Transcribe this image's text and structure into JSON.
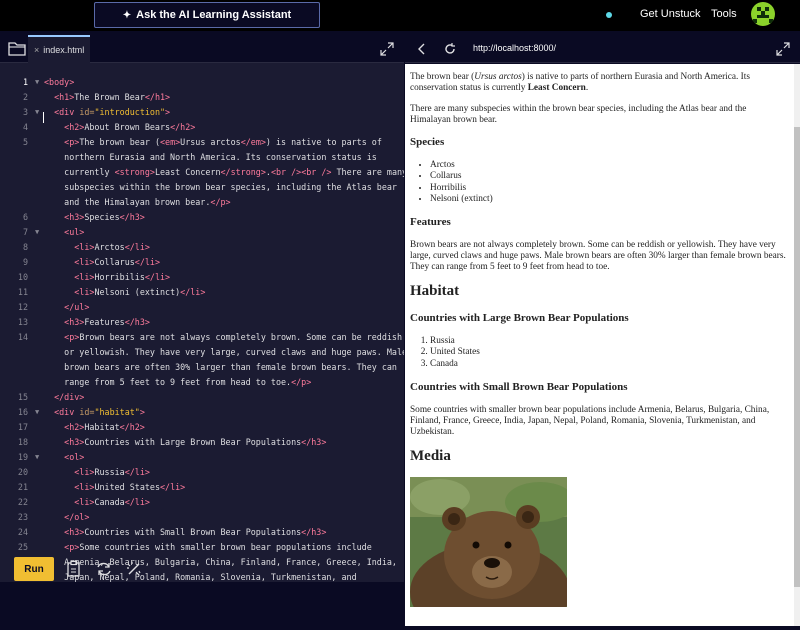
{
  "topbar": {
    "ai_button": "Ask the AI Learning Assistant",
    "get_unstuck": "Get Unstuck",
    "tools": "Tools"
  },
  "editor": {
    "tab_name": "index.html",
    "tab_close": "×",
    "run_label": "Run",
    "lines": [
      {
        "n": "1",
        "fold": true,
        "html": "<span class='tag'>&lt;body&gt;</span>"
      },
      {
        "n": "2",
        "html": "  <span class='tag'>&lt;h1&gt;</span>The Brown Bear<span class='tag'>&lt;/h1&gt;</span>"
      },
      {
        "n": "3",
        "fold": true,
        "html": "  <span class='tag'>&lt;div</span> <span class='attr'>id=</span><span class='str'>\"introduction\"</span><span class='tag'>&gt;</span>"
      },
      {
        "n": "4",
        "html": "    <span class='tag'>&lt;h2&gt;</span>About Brown Bears<span class='tag'>&lt;/h2&gt;</span>"
      },
      {
        "n": "5",
        "html": "    <span class='tag'>&lt;p&gt;</span>The brown bear (<span class='tag'>&lt;em&gt;</span>Ursus arctos<span class='tag'>&lt;/em&gt;</span>) is native to parts of"
      },
      {
        "n": "",
        "html": "    northern Eurasia and North America. Its conservation status is"
      },
      {
        "n": "",
        "html": "    currently <span class='tag'>&lt;strong&gt;</span>Least Concern<span class='tag'>&lt;/strong&gt;</span>.<span class='tag'>&lt;br /&gt;&lt;br /&gt;</span> There are many"
      },
      {
        "n": "",
        "html": "    subspecies within the brown bear species, including the Atlas bear"
      },
      {
        "n": "",
        "html": "    and the Himalayan brown bear.<span class='tag'>&lt;/p&gt;</span>"
      },
      {
        "n": "6",
        "html": "    <span class='tag'>&lt;h3&gt;</span>Species<span class='tag'>&lt;/h3&gt;</span>"
      },
      {
        "n": "7",
        "fold": true,
        "html": "    <span class='tag'>&lt;ul&gt;</span>"
      },
      {
        "n": "8",
        "html": "      <span class='tag'>&lt;li&gt;</span>Arctos<span class='tag'>&lt;/li&gt;</span>"
      },
      {
        "n": "9",
        "html": "      <span class='tag'>&lt;li&gt;</span>Collarus<span class='tag'>&lt;/li&gt;</span>"
      },
      {
        "n": "10",
        "html": "      <span class='tag'>&lt;li&gt;</span>Horribilis<span class='tag'>&lt;/li&gt;</span>"
      },
      {
        "n": "11",
        "html": "      <span class='tag'>&lt;li&gt;</span>Nelsoni (extinct)<span class='tag'>&lt;/li&gt;</span>"
      },
      {
        "n": "12",
        "html": "    <span class='tag'>&lt;/ul&gt;</span>"
      },
      {
        "n": "13",
        "html": "    <span class='tag'>&lt;h3&gt;</span>Features<span class='tag'>&lt;/h3&gt;</span>"
      },
      {
        "n": "14",
        "html": "    <span class='tag'>&lt;p&gt;</span>Brown bears are not always completely brown. Some can be reddish"
      },
      {
        "n": "",
        "html": "    or yellowish. They have very large, curved claws and huge paws. Male"
      },
      {
        "n": "",
        "html": "    brown bears are often 30% larger than female brown bears. They can"
      },
      {
        "n": "",
        "html": "    range from 5 feet to 9 feet from head to toe.<span class='tag'>&lt;/p&gt;</span>"
      },
      {
        "n": "15",
        "html": "  <span class='tag'>&lt;/div&gt;</span>"
      },
      {
        "n": "16",
        "fold": true,
        "html": "  <span class='tag'>&lt;div</span> <span class='attr'>id=</span><span class='str'>\"habitat\"</span><span class='tag'>&gt;</span>"
      },
      {
        "n": "17",
        "html": "    <span class='tag'>&lt;h2&gt;</span>Habitat<span class='tag'>&lt;/h2&gt;</span>"
      },
      {
        "n": "18",
        "html": "    <span class='tag'>&lt;h3&gt;</span>Countries with Large Brown Bear Populations<span class='tag'>&lt;/h3&gt;</span>"
      },
      {
        "n": "19",
        "fold": true,
        "html": "    <span class='tag'>&lt;ol&gt;</span>"
      },
      {
        "n": "20",
        "html": "      <span class='tag'>&lt;li&gt;</span>Russia<span class='tag'>&lt;/li&gt;</span>"
      },
      {
        "n": "21",
        "html": "      <span class='tag'>&lt;li&gt;</span>United States<span class='tag'>&lt;/li&gt;</span>"
      },
      {
        "n": "22",
        "html": "      <span class='tag'>&lt;li&gt;</span>Canada<span class='tag'>&lt;/li&gt;</span>"
      },
      {
        "n": "23",
        "html": "    <span class='tag'>&lt;/ol&gt;</span>"
      },
      {
        "n": "24",
        "html": "    <span class='tag'>&lt;h3&gt;</span>Countries with Small Brown Bear Populations<span class='tag'>&lt;/h3&gt;</span>"
      },
      {
        "n": "25",
        "html": "    <span class='tag'>&lt;p&gt;</span>Some countries with smaller brown bear populations include"
      },
      {
        "n": "",
        "html": "    Armenia, Belarus, Bulgaria, China, Finland, France, Greece, India,"
      },
      {
        "n": "",
        "html": "    Japan, Nepal, Poland, Romania, Slovenia, Turkmenistan, and"
      }
    ]
  },
  "preview": {
    "url": "http://localhost:8000/",
    "intro_p1_a": "The brown bear (",
    "intro_p1_em": "Ursus arctos",
    "intro_p1_b": ") is native to parts of northern Eurasia and North America. Its conservation status is currently ",
    "intro_p1_strong": "Least Concern",
    "intro_p1_c": ".",
    "intro_p2": "There are many subspecies within the brown bear species, including the Atlas bear and the Himalayan brown bear.",
    "species_heading": "Species",
    "species": [
      "Arctos",
      "Collarus",
      "Horribilis",
      "Nelsoni (extinct)"
    ],
    "features_heading": "Features",
    "features_text": "Brown bears are not always completely brown. Some can be reddish or yellowish. They have very large, curved claws and huge paws. Male brown bears are often 30% larger than female brown bears. They can range from 5 feet to 9 feet from head to toe.",
    "habitat_heading": "Habitat",
    "large_heading": "Countries with Large Brown Bear Populations",
    "large_countries": [
      "Russia",
      "United States",
      "Canada"
    ],
    "small_heading": "Countries with Small Brown Bear Populations",
    "small_text": "Some countries with smaller brown bear populations include Armenia, Belarus, Bulgaria, China, Finland, France, Greece, India, Japan, Nepal, Poland, Romania, Slovenia, Turkmenistan, and Uzbekistan.",
    "media_heading": "Media"
  },
  "colors": {
    "tag": "#ff7b9c",
    "attribute": "#c79b66",
    "string": "#f1be32",
    "run_button": "#f1be32",
    "editor_bg": "#1b1b32"
  }
}
